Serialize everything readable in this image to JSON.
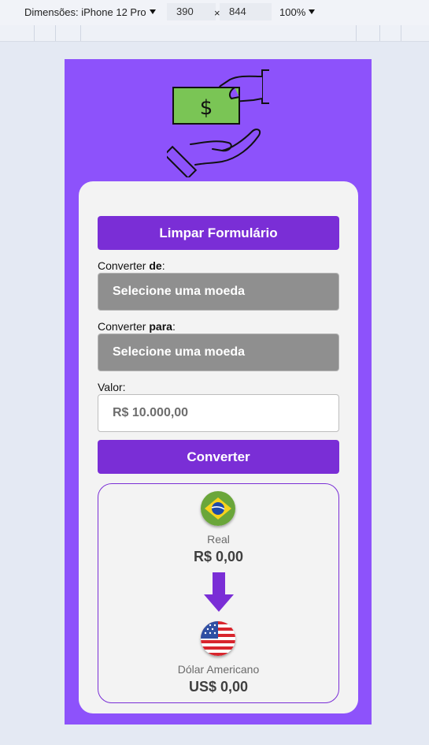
{
  "devtools": {
    "device_label": "Dimensões: iPhone 12 Pro",
    "width": "390",
    "times": "×",
    "height": "844",
    "zoom": "100%"
  },
  "form": {
    "clear_button": "Limpar Formulário",
    "from_label_prefix": "Converter ",
    "from_label_bold": "de",
    "from_label_suffix": ":",
    "from_select_value": "Selecione uma moeda",
    "to_label_prefix": "Converter ",
    "to_label_bold": "para",
    "to_label_suffix": ":",
    "to_select_value": "Selecione uma moeda",
    "value_label": "Valor:",
    "value_placeholder": "R$ 10.000,00",
    "convert_button": "Converter"
  },
  "result": {
    "from_name": "Real",
    "from_value": "R$ 0,00",
    "to_name": "Dólar Americano",
    "to_value": "US$ 0,00"
  },
  "colors": {
    "app_bg": "#8d52fb",
    "button": "#7a2ed6",
    "select": "#8f8f8f"
  }
}
